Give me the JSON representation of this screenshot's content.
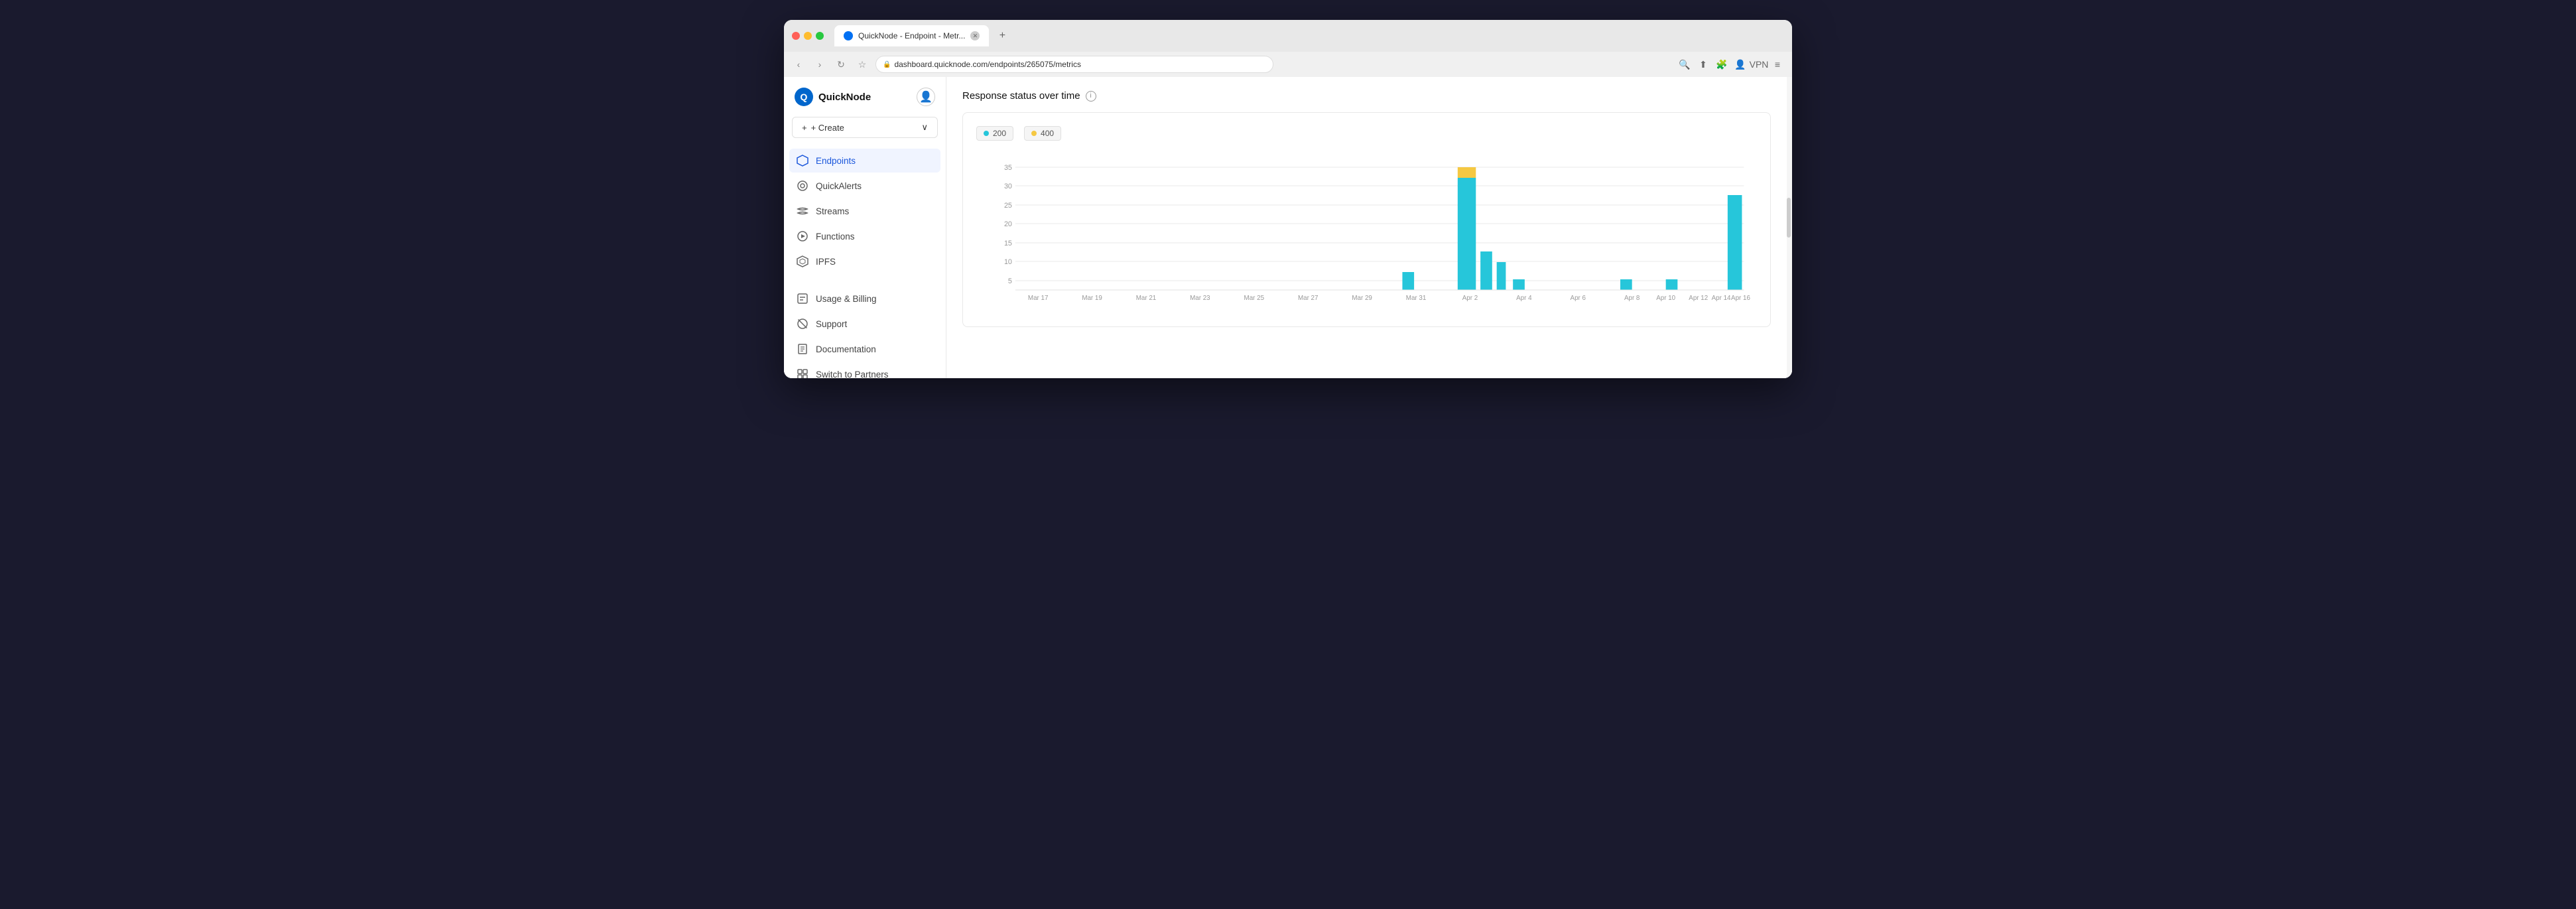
{
  "window": {
    "title": "QuickNode - Endpoint - Metr...",
    "url": "dashboard.quicknode.com/endpoints/265075/metrics"
  },
  "sidebar": {
    "logo_text": "QuickNode",
    "create_label": "+ Create",
    "nav_items": [
      {
        "id": "endpoints",
        "label": "Endpoints",
        "active": true,
        "icon": "⬡"
      },
      {
        "id": "quickalerts",
        "label": "QuickAlerts",
        "active": false,
        "icon": "🔔"
      },
      {
        "id": "streams",
        "label": "Streams",
        "active": false,
        "icon": "⟳"
      },
      {
        "id": "functions",
        "label": "Functions",
        "active": false,
        "icon": "▷"
      },
      {
        "id": "ipfs",
        "label": "IPFS",
        "active": false,
        "icon": "⬡"
      }
    ],
    "bottom_items": [
      {
        "id": "usage-billing",
        "label": "Usage & Billing",
        "icon": "▦"
      },
      {
        "id": "support",
        "label": "Support",
        "icon": "⊕"
      },
      {
        "id": "documentation",
        "label": "Documentation",
        "icon": "▣"
      },
      {
        "id": "switch-partners",
        "label": "Switch to Partners",
        "icon": "⊞"
      }
    ]
  },
  "main": {
    "chart_title": "Response status over time",
    "info_icon_label": "i",
    "legend": [
      {
        "label": "200",
        "color": "#26c6da"
      },
      {
        "label": "400",
        "color": "#f5c842"
      }
    ],
    "x_labels": [
      "Mar 17",
      "Mar 19",
      "Mar 21",
      "Mar 23",
      "Mar 25",
      "Mar 27",
      "Mar 29",
      "Mar 31",
      "Apr 2",
      "Apr 4",
      "Apr 6",
      "Apr 8",
      "Apr 10",
      "Apr 12",
      "Apr 14",
      "Apr 16"
    ],
    "y_labels": [
      "35",
      "30",
      "25",
      "20",
      "15",
      "10",
      "5"
    ],
    "bars": [
      {
        "date": "Mar 31",
        "blue": 5,
        "yellow": 0
      },
      {
        "date": "Apr 2",
        "blue": 32,
        "yellow": 3
      },
      {
        "date": "Apr 2b",
        "blue": 11,
        "yellow": 0
      },
      {
        "date": "Apr 2c",
        "blue": 8,
        "yellow": 0
      },
      {
        "date": "Apr 4",
        "blue": 3,
        "yellow": 0
      },
      {
        "date": "Apr 6",
        "blue": 0,
        "yellow": 0
      },
      {
        "date": "Apr 8",
        "blue": 3,
        "yellow": 0
      },
      {
        "date": "Apr 10",
        "blue": 3,
        "yellow": 0
      },
      {
        "date": "Apr 12",
        "blue": 0,
        "yellow": 0
      },
      {
        "date": "Apr 14",
        "blue": 0,
        "yellow": 0
      },
      {
        "date": "Apr 16",
        "blue": 27,
        "yellow": 0
      }
    ]
  }
}
